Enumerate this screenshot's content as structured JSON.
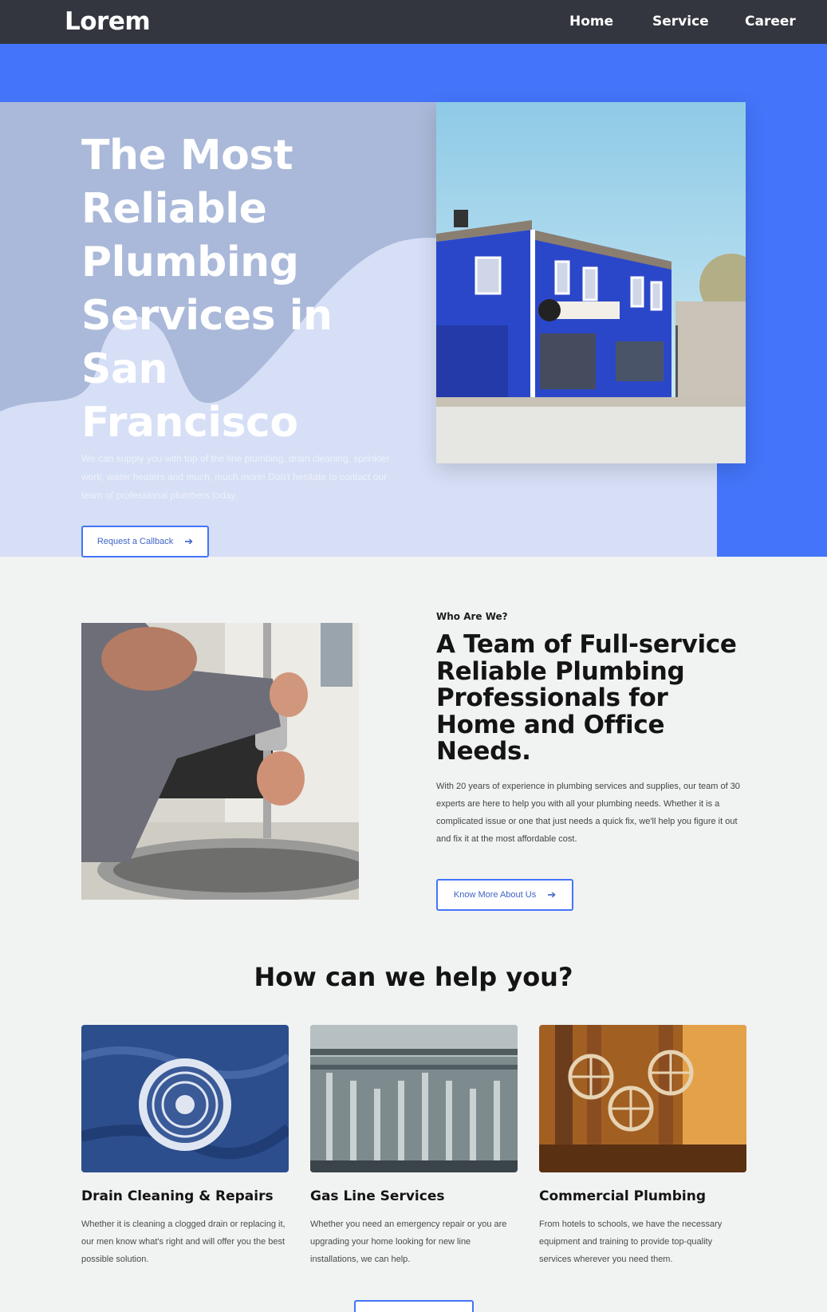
{
  "nav": {
    "logo": "Lorem",
    "links": [
      "Home",
      "Service",
      "Career"
    ]
  },
  "hero": {
    "title_lines": [
      "The Most",
      "Reliable",
      "Plumbing",
      "Services in",
      "San",
      "Francisco"
    ],
    "description": "We can supply you with top of the line plumbing, drain cleaning, sprinkler work, water heaters and much, much more! Don't hesitate to contact our team of professional plumbers today.",
    "cta_label": "Request a Callback",
    "image": "blue plumbing company storefront photo"
  },
  "about": {
    "eyebrow": "Who Are We?",
    "title": "A Team of Full-service Reliable Plumbing Professionals for Home and Office Needs.",
    "body": "With 20 years of experience in plumbing services and supplies, our team of 30 experts are here to help you with all your plumbing needs. Whether it is a complicated issue or one that just needs a quick fix, we'll help you figure it out and fix it at the most affordable cost.",
    "cta_label": "Know More About Us",
    "image": "plumber fixing kitchen faucet photo"
  },
  "services": {
    "title": "How can we help you?",
    "cards": [
      {
        "title": "Drain Cleaning & Repairs",
        "description": "Whether it is cleaning a clogged drain or replacing it, our men know what's right and will offer you the best possible solution.",
        "image": "drain photo"
      },
      {
        "title": "Gas Line Services",
        "description": "Whether you need an emergency repair or you are upgrading your home looking for new line installations, we can help.",
        "image": "gas pipes photo"
      },
      {
        "title": "Commercial Plumbing",
        "description": "From hotels to schools, we have the necessary equipment and training to provide top-quality services wherever you need them.",
        "image": "valves photo"
      }
    ]
  },
  "colors": {
    "accent": "#4474f9",
    "nav_bg": "#33363e",
    "page_bg": "#f1f2f2"
  }
}
